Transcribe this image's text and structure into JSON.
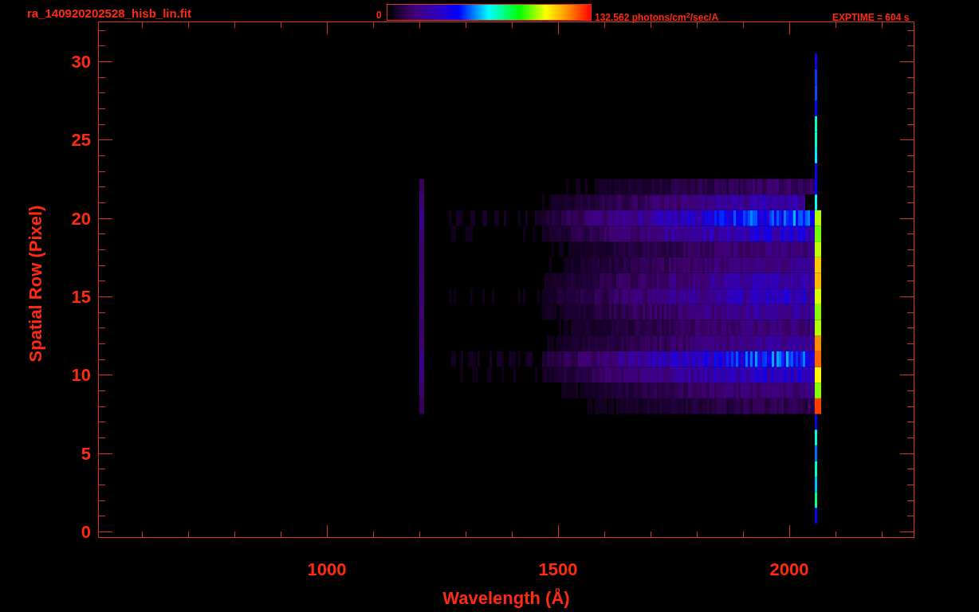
{
  "title": "ra_140920202528_hisb_lin.fit",
  "colorbar": {
    "min_label": "0",
    "max_label": "132.562 photons/cm$^{2}$/sec/A"
  },
  "exposure": "EXPTIME = 604 s",
  "y_axis": {
    "label": "Spatial Row (Pixel)",
    "ticks": [
      "30",
      "25",
      "20",
      "15",
      "10",
      "5",
      "0"
    ]
  },
  "x_axis": {
    "label": "Wavelength (Å)",
    "ticks": [
      "1000",
      "1500",
      "2000"
    ]
  }
}
